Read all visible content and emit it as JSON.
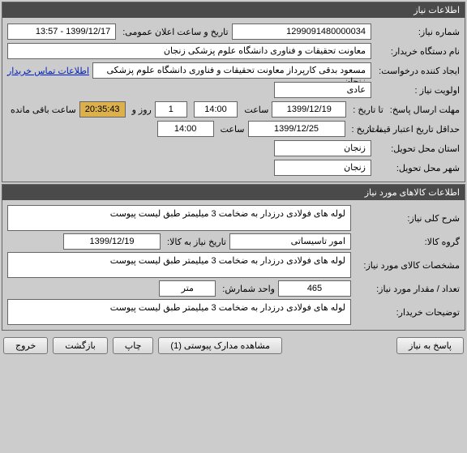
{
  "section1": {
    "title": "اطلاعات نیاز",
    "reqNumLabel": "شماره نیاز:",
    "reqNum": "1299091480000034",
    "announceLabel": "تاریخ و ساعت اعلان عمومی:",
    "announceVal": "1399/12/17 - 13:57",
    "orgLabel": "نام دستگاه خریدار:",
    "orgVal": "معاونت تحقیقات و فناوری دانشگاه علوم پزشکی زنجان",
    "creatorLabel": "ایجاد کننده درخواست:",
    "creatorVal": "مسعود بدقی کارپرداز معاونت تحقیقات و فناوری دانشگاه علوم پزشکی زنجان",
    "contactLink": "اطلاعات تماس خریدار",
    "priorityLabel": "اولویت نیاز :",
    "priorityVal": "عادی",
    "deadlineLabel": "مهلت ارسال پاسخ:",
    "toDateLabel": "تا تاریخ :",
    "deadlineDate": "1399/12/19",
    "timeLabel": "ساعت",
    "deadlineTime": "14:00",
    "daysVal": "1",
    "daysSuffix": "روز و",
    "countdown": "20:35:43",
    "remainSuffix": "ساعت باقی مانده",
    "minValidLabel": "حداقل تاریخ اعتبار قیمت:",
    "minValidToLabel": "تا تاریخ :",
    "minValidDate": "1399/12/25",
    "minValidTime": "14:00",
    "provinceLabel": "استان محل تحویل:",
    "provinceVal": "زنجان",
    "cityLabel": "شهر محل تحویل:",
    "cityVal": "زنجان"
  },
  "section2": {
    "title": "اطلاعات کالاهای مورد نیاز",
    "descLabel": "شرح کلی نیاز:",
    "descVal": "لوله های فولادی درزدار به ضخامت 3 میلیمتر طبق لیست پیوست",
    "groupLabel": "گروه کالا:",
    "groupVal": "امور تاسیساتی",
    "needDateLabel": "تاریخ نیاز به کالا:",
    "needDateVal": "1399/12/19",
    "specLabel": "مشخصات کالای مورد نیاز:",
    "specVal": "لوله های فولادی درزدار به ضخامت 3 میلیمتر طبق لیست پیوست",
    "qtyLabel": "تعداد / مقدار مورد نیاز:",
    "qtyVal": "465",
    "unitLabel": "واحد شمارش:",
    "unitVal": "متر",
    "buyerNotesLabel": "توضیحات خریدار:",
    "buyerNotesVal": "لوله های فولادی درزدار به ضخامت 3 میلیمتر طبق لیست پیوست"
  },
  "buttons": {
    "respond": "پاسخ به نیاز",
    "attachments": "مشاهده مدارک پیوستی  (1)",
    "print": "چاپ",
    "back": "بازگشت",
    "exit": "خروج"
  }
}
